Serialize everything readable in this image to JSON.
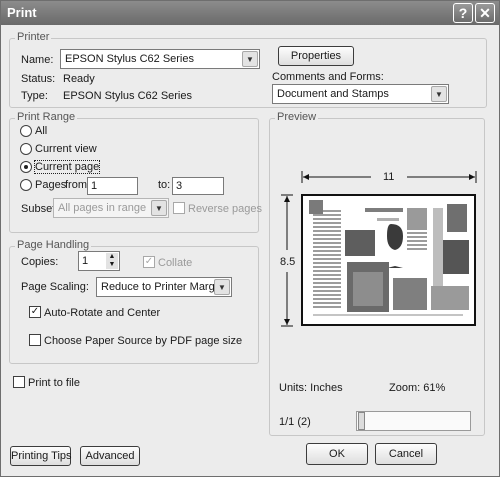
{
  "window": {
    "title": "Print",
    "help_glyph": "?",
    "close_glyph": "✕"
  },
  "printer": {
    "group_label": "Printer",
    "name_label": "Name:",
    "name_value": "EPSON Stylus C62 Series",
    "properties_label": "Properties",
    "status_label": "Status:",
    "status_value": "Ready",
    "type_label": "Type:",
    "type_value": "EPSON Stylus C62 Series",
    "comments_label": "Comments and Forms:",
    "comments_value": "Document and Stamps"
  },
  "print_range": {
    "group_label": "Print Range",
    "all_label": "All",
    "current_view_label": "Current view",
    "current_page_label": "Current page",
    "pages_label": "Pages",
    "from_label": "from:",
    "from_value": "1",
    "to_label": "to:",
    "to_value": "3",
    "subset_label": "Subset:",
    "subset_value": "All pages in range",
    "reverse_label": "Reverse pages",
    "selected": "current_page"
  },
  "page_handling": {
    "group_label": "Page Handling",
    "copies_label": "Copies:",
    "copies_value": "1",
    "collate_label": "Collate",
    "scaling_label": "Page Scaling:",
    "scaling_value": "Reduce to Printer Margins",
    "auto_rotate_label": "Auto-Rotate and Center",
    "auto_rotate_checked": true,
    "paper_source_label": "Choose Paper Source by PDF page size",
    "paper_source_checked": false
  },
  "print_to_file_label": "Print to file",
  "preview": {
    "group_label": "Preview",
    "width_label": "11",
    "height_label": "8.5",
    "units_label": "Units: Inches",
    "zoom_label": "Zoom:  61%",
    "page_indicator": "1/1 (2)",
    "page_position": 0.0
  },
  "buttons": {
    "printing_tips": "Printing Tips",
    "advanced": "Advanced",
    "ok": "OK",
    "cancel": "Cancel"
  }
}
